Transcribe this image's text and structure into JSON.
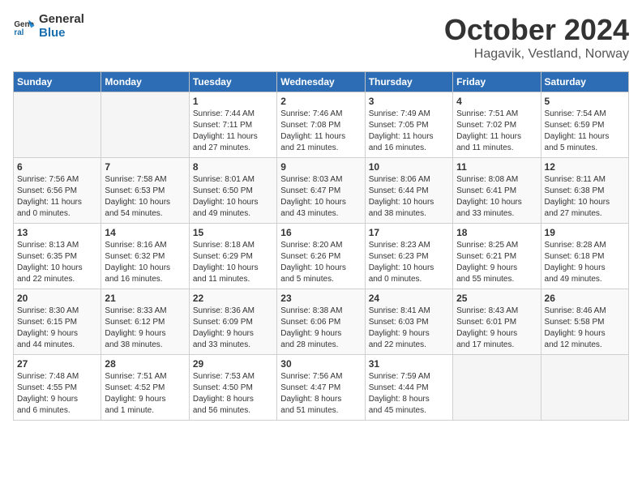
{
  "header": {
    "logo_general": "General",
    "logo_blue": "Blue",
    "month_title": "October 2024",
    "location": "Hagavik, Vestland, Norway"
  },
  "weekdays": [
    "Sunday",
    "Monday",
    "Tuesday",
    "Wednesday",
    "Thursday",
    "Friday",
    "Saturday"
  ],
  "weeks": [
    [
      {
        "day": "",
        "info": ""
      },
      {
        "day": "",
        "info": ""
      },
      {
        "day": "1",
        "info": "Sunrise: 7:44 AM\nSunset: 7:11 PM\nDaylight: 11 hours\nand 27 minutes."
      },
      {
        "day": "2",
        "info": "Sunrise: 7:46 AM\nSunset: 7:08 PM\nDaylight: 11 hours\nand 21 minutes."
      },
      {
        "day": "3",
        "info": "Sunrise: 7:49 AM\nSunset: 7:05 PM\nDaylight: 11 hours\nand 16 minutes."
      },
      {
        "day": "4",
        "info": "Sunrise: 7:51 AM\nSunset: 7:02 PM\nDaylight: 11 hours\nand 11 minutes."
      },
      {
        "day": "5",
        "info": "Sunrise: 7:54 AM\nSunset: 6:59 PM\nDaylight: 11 hours\nand 5 minutes."
      }
    ],
    [
      {
        "day": "6",
        "info": "Sunrise: 7:56 AM\nSunset: 6:56 PM\nDaylight: 11 hours\nand 0 minutes."
      },
      {
        "day": "7",
        "info": "Sunrise: 7:58 AM\nSunset: 6:53 PM\nDaylight: 10 hours\nand 54 minutes."
      },
      {
        "day": "8",
        "info": "Sunrise: 8:01 AM\nSunset: 6:50 PM\nDaylight: 10 hours\nand 49 minutes."
      },
      {
        "day": "9",
        "info": "Sunrise: 8:03 AM\nSunset: 6:47 PM\nDaylight: 10 hours\nand 43 minutes."
      },
      {
        "day": "10",
        "info": "Sunrise: 8:06 AM\nSunset: 6:44 PM\nDaylight: 10 hours\nand 38 minutes."
      },
      {
        "day": "11",
        "info": "Sunrise: 8:08 AM\nSunset: 6:41 PM\nDaylight: 10 hours\nand 33 minutes."
      },
      {
        "day": "12",
        "info": "Sunrise: 8:11 AM\nSunset: 6:38 PM\nDaylight: 10 hours\nand 27 minutes."
      }
    ],
    [
      {
        "day": "13",
        "info": "Sunrise: 8:13 AM\nSunset: 6:35 PM\nDaylight: 10 hours\nand 22 minutes."
      },
      {
        "day": "14",
        "info": "Sunrise: 8:16 AM\nSunset: 6:32 PM\nDaylight: 10 hours\nand 16 minutes."
      },
      {
        "day": "15",
        "info": "Sunrise: 8:18 AM\nSunset: 6:29 PM\nDaylight: 10 hours\nand 11 minutes."
      },
      {
        "day": "16",
        "info": "Sunrise: 8:20 AM\nSunset: 6:26 PM\nDaylight: 10 hours\nand 5 minutes."
      },
      {
        "day": "17",
        "info": "Sunrise: 8:23 AM\nSunset: 6:23 PM\nDaylight: 10 hours\nand 0 minutes."
      },
      {
        "day": "18",
        "info": "Sunrise: 8:25 AM\nSunset: 6:21 PM\nDaylight: 9 hours\nand 55 minutes."
      },
      {
        "day": "19",
        "info": "Sunrise: 8:28 AM\nSunset: 6:18 PM\nDaylight: 9 hours\nand 49 minutes."
      }
    ],
    [
      {
        "day": "20",
        "info": "Sunrise: 8:30 AM\nSunset: 6:15 PM\nDaylight: 9 hours\nand 44 minutes."
      },
      {
        "day": "21",
        "info": "Sunrise: 8:33 AM\nSunset: 6:12 PM\nDaylight: 9 hours\nand 38 minutes."
      },
      {
        "day": "22",
        "info": "Sunrise: 8:36 AM\nSunset: 6:09 PM\nDaylight: 9 hours\nand 33 minutes."
      },
      {
        "day": "23",
        "info": "Sunrise: 8:38 AM\nSunset: 6:06 PM\nDaylight: 9 hours\nand 28 minutes."
      },
      {
        "day": "24",
        "info": "Sunrise: 8:41 AM\nSunset: 6:03 PM\nDaylight: 9 hours\nand 22 minutes."
      },
      {
        "day": "25",
        "info": "Sunrise: 8:43 AM\nSunset: 6:01 PM\nDaylight: 9 hours\nand 17 minutes."
      },
      {
        "day": "26",
        "info": "Sunrise: 8:46 AM\nSunset: 5:58 PM\nDaylight: 9 hours\nand 12 minutes."
      }
    ],
    [
      {
        "day": "27",
        "info": "Sunrise: 7:48 AM\nSunset: 4:55 PM\nDaylight: 9 hours\nand 6 minutes."
      },
      {
        "day": "28",
        "info": "Sunrise: 7:51 AM\nSunset: 4:52 PM\nDaylight: 9 hours\nand 1 minute."
      },
      {
        "day": "29",
        "info": "Sunrise: 7:53 AM\nSunset: 4:50 PM\nDaylight: 8 hours\nand 56 minutes."
      },
      {
        "day": "30",
        "info": "Sunrise: 7:56 AM\nSunset: 4:47 PM\nDaylight: 8 hours\nand 51 minutes."
      },
      {
        "day": "31",
        "info": "Sunrise: 7:59 AM\nSunset: 4:44 PM\nDaylight: 8 hours\nand 45 minutes."
      },
      {
        "day": "",
        "info": ""
      },
      {
        "day": "",
        "info": ""
      }
    ]
  ]
}
